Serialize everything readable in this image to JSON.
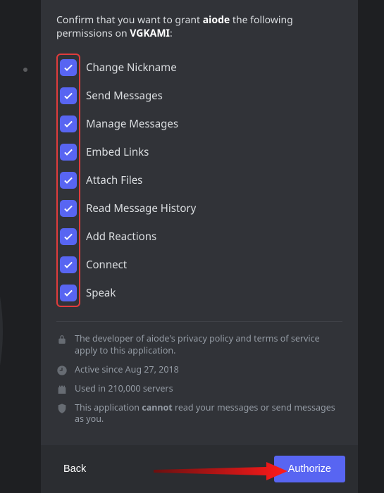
{
  "confirm": {
    "prefix": "Confirm that you want to grant ",
    "app_name": "aiode",
    "middle": " the following permissions on ",
    "server_name": "VGKAMI",
    "suffix": ":"
  },
  "permissions": [
    {
      "label": "Change Nickname",
      "checked": true
    },
    {
      "label": "Send Messages",
      "checked": true
    },
    {
      "label": "Manage Messages",
      "checked": true
    },
    {
      "label": "Embed Links",
      "checked": true
    },
    {
      "label": "Attach Files",
      "checked": true
    },
    {
      "label": "Read Message History",
      "checked": true
    },
    {
      "label": "Add Reactions",
      "checked": true
    },
    {
      "label": "Connect",
      "checked": true
    },
    {
      "label": "Speak",
      "checked": true
    }
  ],
  "info": {
    "privacy": "The developer of aiode's privacy policy and terms of service apply to this application.",
    "active": "Active since Aug 27, 2018",
    "servers": "Used in 210,000 servers",
    "security_prefix": "This application ",
    "security_cannot": "cannot",
    "security_suffix": " read your messages or send messages as you."
  },
  "footer": {
    "back": "Back",
    "authorize": "Authorize"
  },
  "colors": {
    "accent": "#5865f2",
    "highlight_border": "#e03c3c"
  }
}
